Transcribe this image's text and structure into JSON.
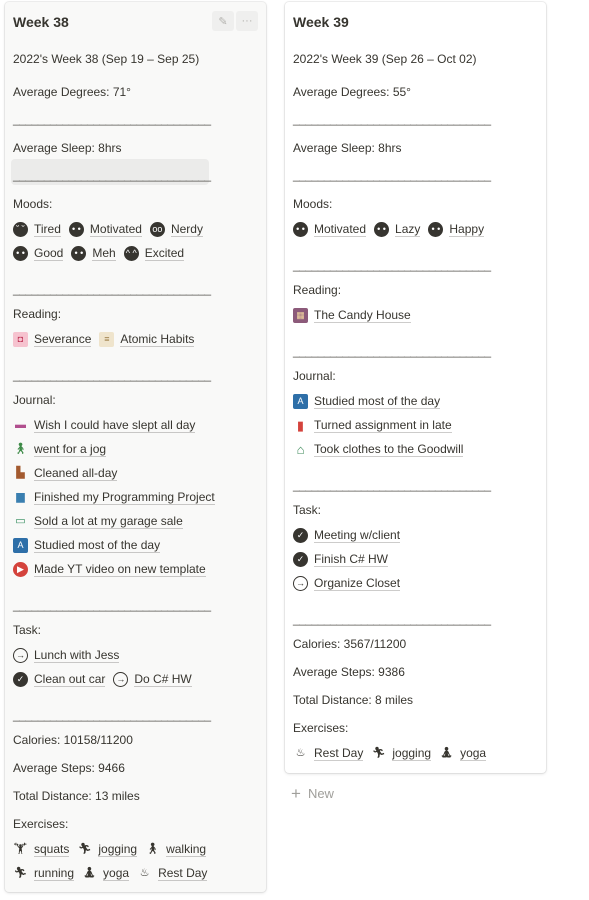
{
  "cards": [
    {
      "title": "Week 38",
      "subtitle": "2022's Week 38 (Sep 19 – Sep 25)",
      "avg_degrees": "Average Degrees: 71°",
      "divider": "________________________________",
      "avg_sleep": "Average Sleep: 8hrs",
      "moods_label": "Moods:",
      "moods_row1": [
        {
          "icon": "tired-face-icon",
          "label": "Tired"
        },
        {
          "icon": "smiling-face-icon",
          "label": "Motivated"
        },
        {
          "icon": "nerd-face-icon",
          "label": "Nerdy"
        }
      ],
      "moods_row2": [
        {
          "icon": "smiling-face-icon",
          "label": "Good"
        },
        {
          "icon": "neutral-face-icon",
          "label": "Meh"
        },
        {
          "icon": "grinning-face-icon",
          "label": "Excited"
        }
      ],
      "reading_label": "Reading:",
      "reading": [
        {
          "icon": "severance-book-cover-icon",
          "label": "Severance"
        },
        {
          "icon": "atomic-habits-book-cover-icon",
          "label": "Atomic Habits"
        }
      ],
      "journal_label": "Journal:",
      "journal": [
        {
          "icon": "bed-icon",
          "label": "Wish I could have slept all day"
        },
        {
          "icon": "person-walking-icon",
          "label": "went for a jog"
        },
        {
          "icon": "boot-icon",
          "label": "Cleaned all-day"
        },
        {
          "icon": "desktop-computer-icon",
          "label": "Finished my Programming Project"
        },
        {
          "icon": "money-bill-icon",
          "label": "Sold a lot at my garage sale"
        },
        {
          "icon": "study-book-icon",
          "label": "Studied most of the day"
        },
        {
          "icon": "play-button-icon",
          "label": "Made YT video on new template"
        }
      ],
      "task_label": "Task:",
      "tasks_row1": [
        {
          "icon": "arrow-circle-icon",
          "label": "Lunch with Jess"
        }
      ],
      "tasks_row2": [
        {
          "icon": "check-circle-icon",
          "label": "Clean out car"
        },
        {
          "icon": "arrow-circle-icon",
          "label": "Do C# HW"
        }
      ],
      "calories": "Calories: 10158/11200",
      "avg_steps": "Average Steps: 9466",
      "total_distance": "Total Distance: 13 miles",
      "exercises_label": "Exercises:",
      "exercises_row1": [
        {
          "icon": "squat-figure-icon",
          "label": "squats"
        },
        {
          "icon": "running-figure-icon",
          "label": "jogging"
        },
        {
          "icon": "walking-figure-icon",
          "label": "walking"
        }
      ],
      "exercises_row2": [
        {
          "icon": "running-figure-icon",
          "label": "running"
        },
        {
          "icon": "yoga-figure-icon",
          "label": "yoga"
        },
        {
          "icon": "resting-figure-icon",
          "label": "Rest Day"
        }
      ]
    },
    {
      "title": "Week 39",
      "subtitle": "2022's Week 39 (Sep 26 – Oct 02)",
      "avg_degrees": "Average Degrees: 55°",
      "divider": "________________________________",
      "avg_sleep": "Average Sleep: 8hrs",
      "moods_label": "Moods:",
      "moods_row1": [
        {
          "icon": "smiling-face-icon",
          "label": "Motivated"
        },
        {
          "icon": "neutral-face-icon",
          "label": "Lazy"
        },
        {
          "icon": "smiling-face-icon",
          "label": "Happy"
        }
      ],
      "reading_label": "Reading:",
      "reading": [
        {
          "icon": "candy-house-book-cover-icon",
          "label": "The Candy House"
        }
      ],
      "journal_label": "Journal:",
      "journal": [
        {
          "icon": "study-book-icon",
          "label": "Studied most of the day"
        },
        {
          "icon": "document-icon",
          "label": "Turned assignment in late"
        },
        {
          "icon": "hanger-icon",
          "label": "Took clothes to the Goodwill"
        }
      ],
      "task_label": "Task:",
      "tasks": [
        {
          "icon": "check-circle-icon",
          "label": "Meeting w/client"
        },
        {
          "icon": "check-circle-icon",
          "label": "Finish C# HW"
        },
        {
          "icon": "arrow-circle-icon",
          "label": "Organize Closet"
        }
      ],
      "calories": "Calories: 3567/11200",
      "avg_steps": "Average Steps: 9386",
      "total_distance": "Total Distance: 8 miles",
      "exercises_label": "Exercises:",
      "exercises": [
        {
          "icon": "resting-figure-icon",
          "label": "Rest Day"
        },
        {
          "icon": "running-figure-icon",
          "label": "jogging"
        },
        {
          "icon": "yoga-figure-icon",
          "label": "yoga"
        }
      ]
    }
  ],
  "new_label": "New",
  "colors": {
    "text": "#37352f",
    "muted": "#a09f9b",
    "card_bg_selected": "#f9f9f8",
    "row_highlight": "#ebebea"
  }
}
